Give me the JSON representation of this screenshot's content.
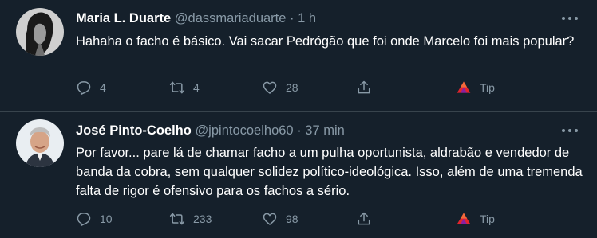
{
  "tweets": [
    {
      "name": "Maria L. Duarte",
      "handle": "@dassmariaduarte",
      "dot": "·",
      "time": "1 h",
      "text": "Hahaha o facho é básico. Vai sacar Pedrógão que foi onde Marcelo foi mais popular?",
      "replies": "4",
      "retweets": "4",
      "likes": "28",
      "tip": "Tip"
    },
    {
      "name": "José Pinto-Coelho",
      "handle": "@jpintocoelho60",
      "dot": "·",
      "time": "37 min",
      "text": "Por favor... pare lá de chamar facho a um pulha oportunista, aldrabão e vendedor de banda da cobra, sem qualquer solidez político-ideológica. Isso, além de uma tremenda falta de rigor é ofensivo para os fachos a sério.",
      "replies": "10",
      "retweets": "233",
      "likes": "98",
      "tip": "Tip"
    }
  ],
  "colors": {
    "background": "#15202b",
    "text": "#ffffff",
    "secondary": "#8899a6",
    "divider": "#38444d",
    "tip_brand": "#e2242c"
  },
  "icons": [
    "reply-icon",
    "retweet-icon",
    "like-icon",
    "share-icon",
    "tip-icon",
    "more-icon"
  ]
}
